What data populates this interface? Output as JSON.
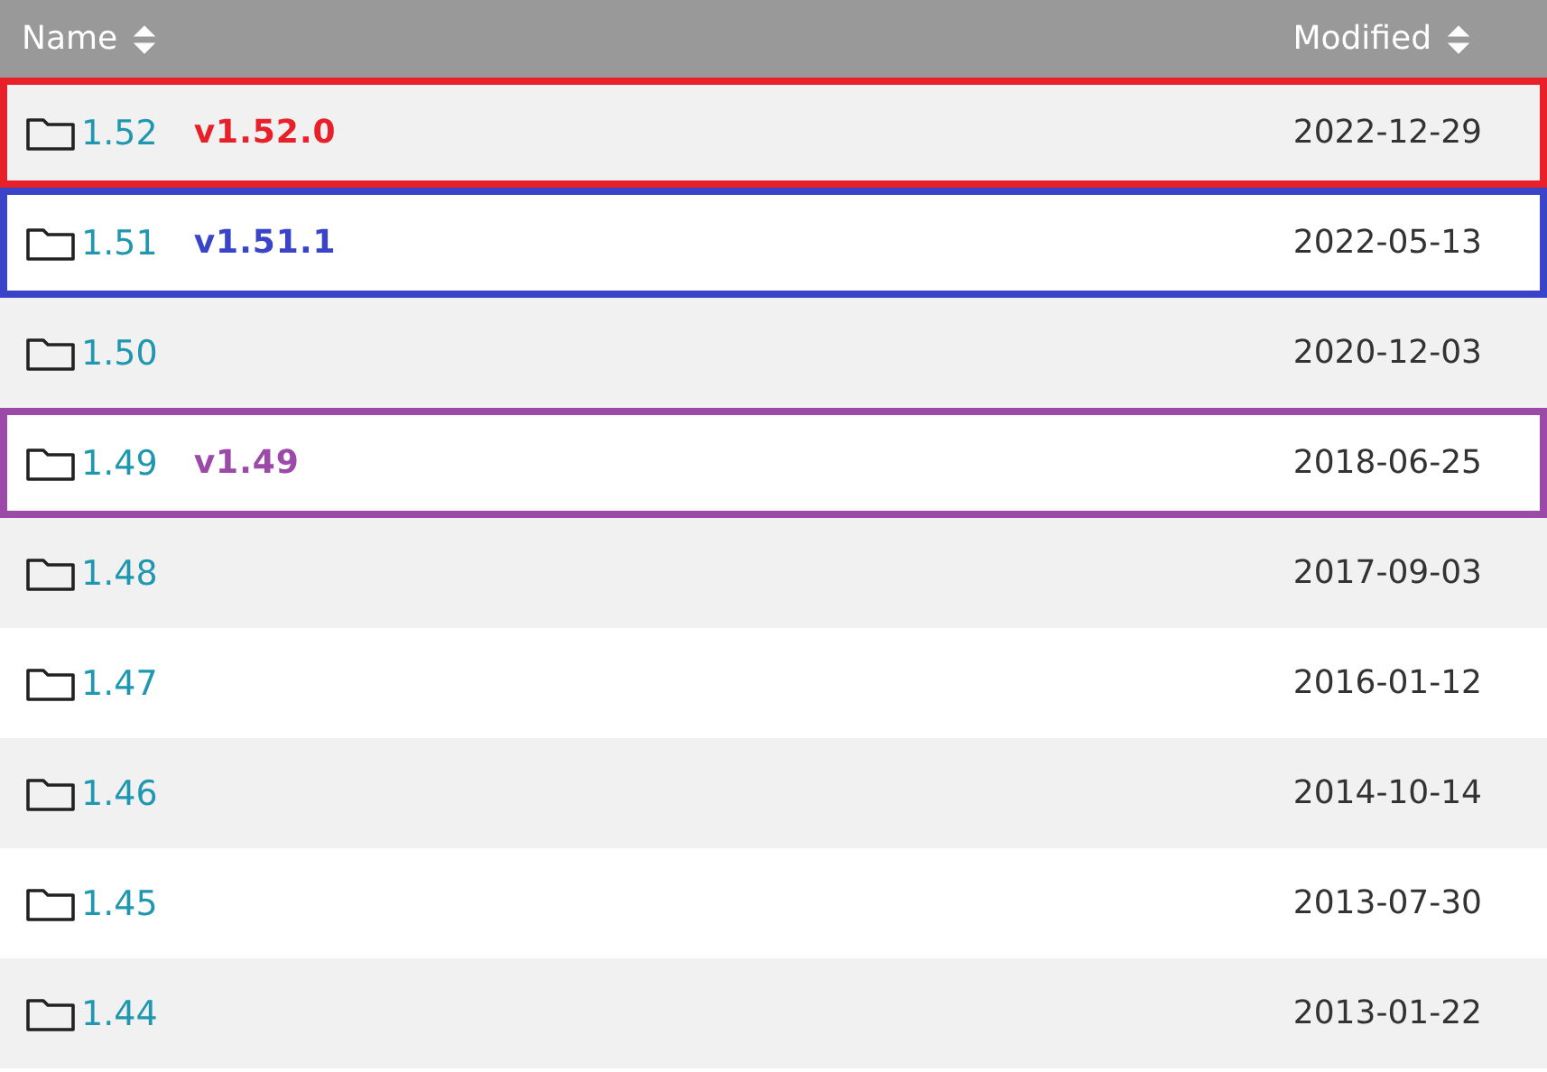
{
  "table": {
    "columns": [
      {
        "label": "Name",
        "sortable": true
      },
      {
        "label": "Modified",
        "sortable": true
      }
    ],
    "rows": [
      {
        "name": "1.52",
        "tag": "v1.52.0",
        "modified": "2022-12-29",
        "color": "#e8202a"
      },
      {
        "name": "1.51",
        "tag": "v1.51.1",
        "modified": "2022-05-13",
        "color": "#3a44c8"
      },
      {
        "name": "1.50",
        "modified": "2020-12-03"
      },
      {
        "name": "1.49",
        "tag": "v1.49",
        "modified": "2018-06-25",
        "color": "#9b4aa8"
      },
      {
        "name": "1.48",
        "modified": "2017-09-03"
      },
      {
        "name": "1.47",
        "modified": "2016-01-12"
      },
      {
        "name": "1.46",
        "modified": "2014-10-14"
      },
      {
        "name": "1.45",
        "modified": "2013-07-30"
      },
      {
        "name": "1.44",
        "modified": "2013-01-22"
      }
    ]
  }
}
